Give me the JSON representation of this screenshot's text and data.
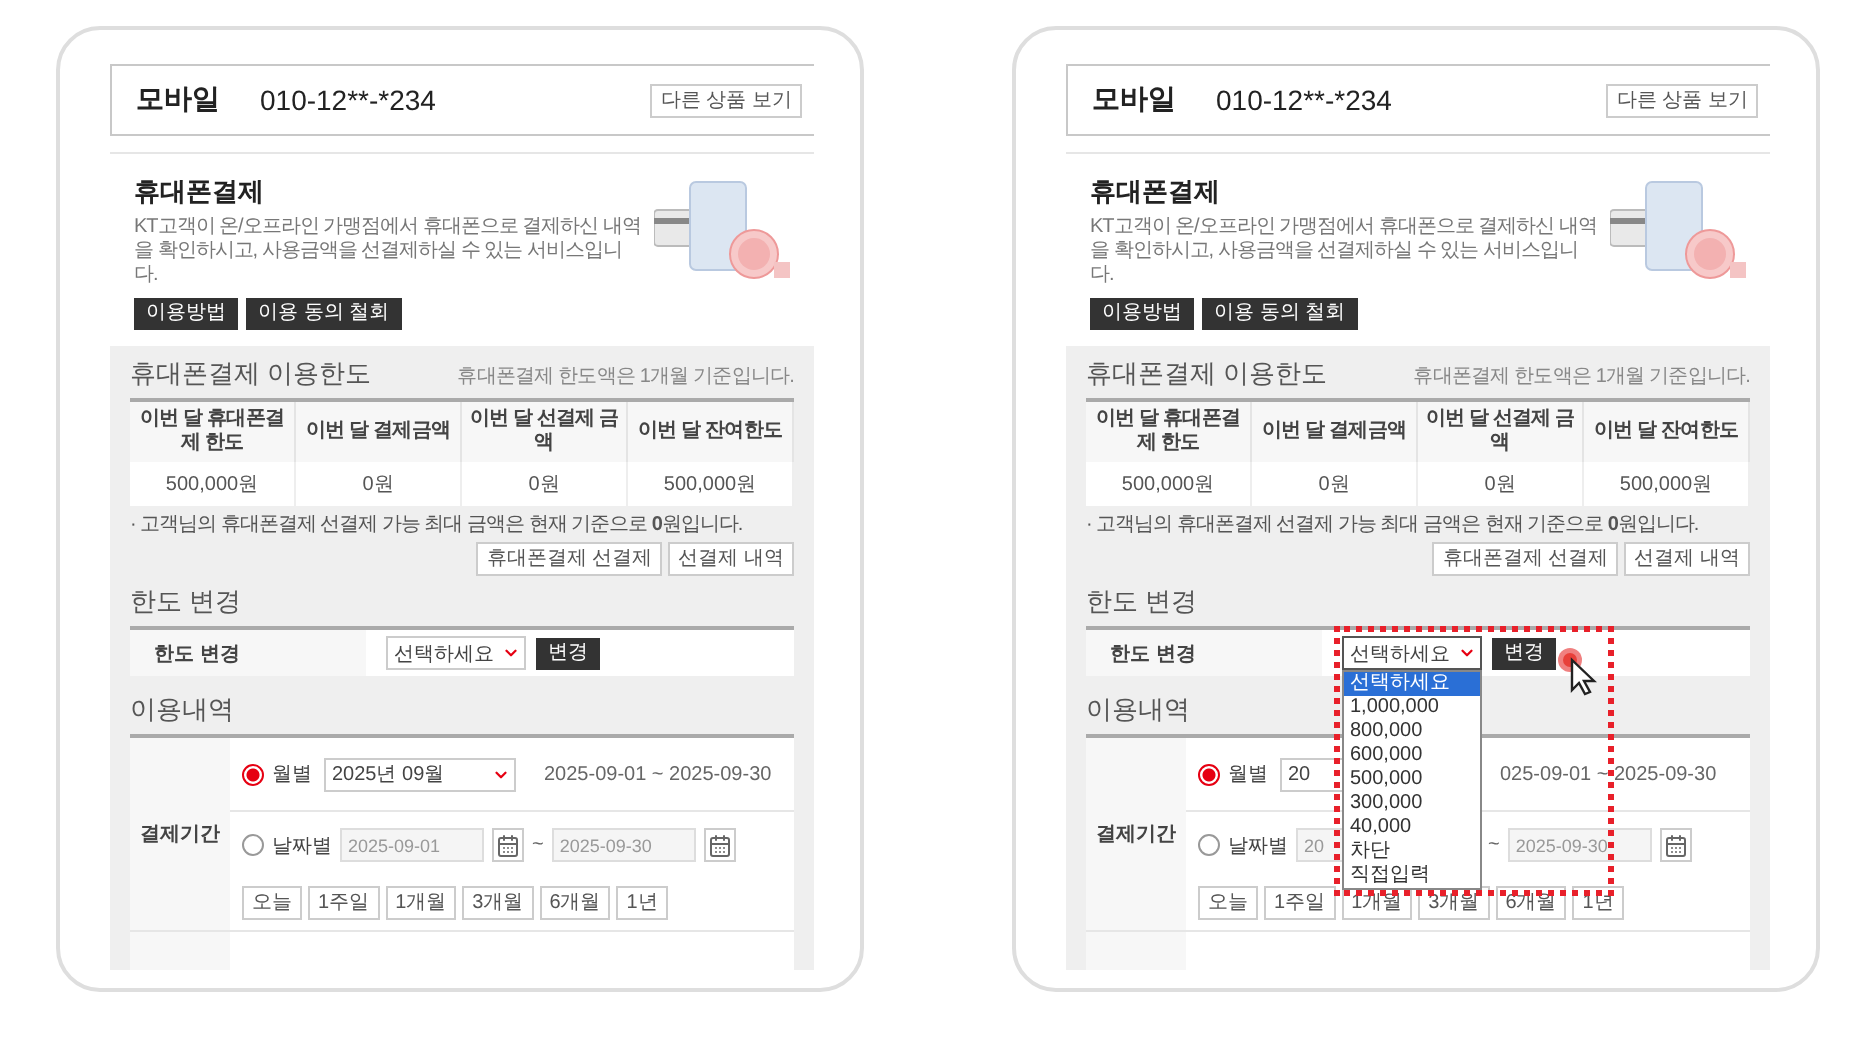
{
  "panels": [
    {
      "product": {
        "label": "모바일",
        "number": "010-12**-*234",
        "button": "다른 상품 보기"
      },
      "intro": {
        "title": "휴대폰결제",
        "description": "KT고객이 온/오프라인 가맹점에서 휴대폰으로 결제하신 내역을 확인하시고, 사용금액을 선결제하실 수 있는 서비스입니다.",
        "buttons": [
          "이용방법",
          "이용 동의 철회"
        ]
      },
      "limit": {
        "title": "휴대폰결제 이용한도",
        "note": "휴대폰결제 한도액은 1개월 기준입니다.",
        "columns": [
          "이번 달 휴대폰결제 한도",
          "이번 달 결제금액",
          "이번 달 선결제 금액",
          "이번 달 잔여한도"
        ],
        "values": [
          "500,000원",
          "0원",
          "0원",
          "500,000원"
        ],
        "notice": "· 고객님의 휴대폰결제 선결제 가능 최대 금액은 현재 기준으로 **0**원입니다.",
        "buttons": [
          "휴대폰결제 선결제",
          "선결제 내역"
        ]
      },
      "limit_change": {
        "title": "한도 변경",
        "label": "한도 변경",
        "select": "선택하세요",
        "button": "변경",
        "open": false
      },
      "usage": {
        "title": "이용내역",
        "label": "결제기간",
        "monthly": {
          "label": "월별",
          "selected": true,
          "select": "2025년 09월",
          "covered": false,
          "range": "2025-09-01 ~ 2025-09-30"
        },
        "daily": {
          "label": "날짜별",
          "selected": false,
          "start": "2025-09-01",
          "start_covered": false,
          "separator": "~",
          "end": "2025-09-30"
        },
        "quick": [
          "오늘",
          "1주일",
          "1개월",
          "3개월",
          "6개월",
          "1년"
        ]
      }
    },
    {
      "product": {
        "label": "모바일",
        "number": "010-12**-*234",
        "button": "다른 상품 보기"
      },
      "intro": {
        "title": "휴대폰결제",
        "description": "KT고객이 온/오프라인 가맹점에서 휴대폰으로 결제하신 내역을 확인하시고, 사용금액을 선결제하실 수 있는 서비스입니다.",
        "buttons": [
          "이용방법",
          "이용 동의 철회"
        ]
      },
      "limit": {
        "title": "휴대폰결제 이용한도",
        "note": "휴대폰결제 한도액은 1개월 기준입니다.",
        "columns": [
          "이번 달 휴대폰결제 한도",
          "이번 달 결제금액",
          "이번 달 선결제 금액",
          "이번 달 잔여한도"
        ],
        "values": [
          "500,000원",
          "0원",
          "0원",
          "500,000원"
        ],
        "notice": "· 고객님의 휴대폰결제 선결제 가능 최대 금액은 현재 기준으로 **0**원입니다.",
        "buttons": [
          "휴대폰결제 선결제",
          "선결제 내역"
        ]
      },
      "limit_change": {
        "title": "한도 변경",
        "label": "한도 변경",
        "select": "선택하세요",
        "button": "변경",
        "open": true,
        "options": [
          {
            "label": "선택하세요",
            "selected": true
          },
          {
            "label": "1,000,000",
            "selected": false
          },
          {
            "label": "800,000",
            "selected": false
          },
          {
            "label": "600,000",
            "selected": false
          },
          {
            "label": "500,000",
            "selected": false
          },
          {
            "label": "300,000",
            "selected": false
          },
          {
            "label": "40,000",
            "selected": false
          },
          {
            "label": "차단",
            "selected": false
          },
          {
            "label": "직접입력",
            "selected": false
          }
        ]
      },
      "usage": {
        "title": "이용내역",
        "label": "결제기간",
        "monthly": {
          "label": "월별",
          "selected": true,
          "select": "20",
          "covered": true,
          "range": "025-09-01 ~ 2025-09-30"
        },
        "daily": {
          "label": "날짜별",
          "selected": false,
          "start": "20",
          "start_covered": true,
          "separator": "~",
          "end": "2025-09-30"
        },
        "quick": [
          "오늘",
          "1주일",
          "1개월",
          "3개월",
          "6개월",
          "1년"
        ]
      }
    }
  ]
}
